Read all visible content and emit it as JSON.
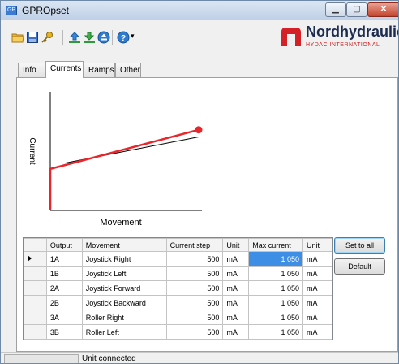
{
  "window": {
    "title": "GPROpset",
    "app_icon_label": "GP",
    "min_glyph": "▁",
    "max_glyph": "▢",
    "close_glyph": "✕"
  },
  "toolbar": {
    "icons": [
      "open-folder-icon",
      "save-icon",
      "key-icon",
      "upload-icon",
      "download-icon",
      "eject-icon",
      "help-icon"
    ],
    "help_dropdown_glyph": "▾"
  },
  "logo": {
    "name": "Nordhydraulic",
    "subtitle": "HYDAC INTERNATIONAL"
  },
  "tabs": [
    {
      "label": "Info",
      "active": false
    },
    {
      "label": "Currents",
      "active": true
    },
    {
      "label": "Ramps",
      "active": false
    },
    {
      "label": "Other",
      "active": false
    }
  ],
  "chart_data": {
    "type": "line",
    "xlabel": "Movement",
    "ylabel": "Current",
    "series": [
      {
        "color": "#e8262b",
        "points": [
          [
            0,
            0
          ],
          [
            0,
            0.35
          ],
          [
            1,
            0.68
          ]
        ]
      },
      {
        "color": "#000000",
        "points": [
          [
            0.1,
            0.4
          ],
          [
            1,
            0.62
          ]
        ]
      }
    ],
    "grid": false
  },
  "table": {
    "columns": [
      "Output",
      "Movement",
      "Current step",
      "Unit",
      "Max current",
      "Unit"
    ],
    "rows": [
      {
        "output": "1A",
        "movement": "Joystick Right",
        "current_step": "500",
        "unit1": "mA",
        "max_current": "1 050",
        "unit2": "mA",
        "selected": true
      },
      {
        "output": "1B",
        "movement": "Joystick Left",
        "current_step": "500",
        "unit1": "mA",
        "max_current": "1 050",
        "unit2": "mA"
      },
      {
        "output": "2A",
        "movement": "Joystick Forward",
        "current_step": "500",
        "unit1": "mA",
        "max_current": "1 050",
        "unit2": "mA"
      },
      {
        "output": "2B",
        "movement": "Joystick Backward",
        "current_step": "500",
        "unit1": "mA",
        "max_current": "1 050",
        "unit2": "mA"
      },
      {
        "output": "3A",
        "movement": "Roller Right",
        "current_step": "500",
        "unit1": "mA",
        "max_current": "1 050",
        "unit2": "mA"
      },
      {
        "output": "3B",
        "movement": "Roller Left",
        "current_step": "500",
        "unit1": "mA",
        "max_current": "1 050",
        "unit2": "mA"
      }
    ]
  },
  "buttons": {
    "set_to_all": "Set to all",
    "default": "Default"
  },
  "status": {
    "text": "Unit connected"
  }
}
